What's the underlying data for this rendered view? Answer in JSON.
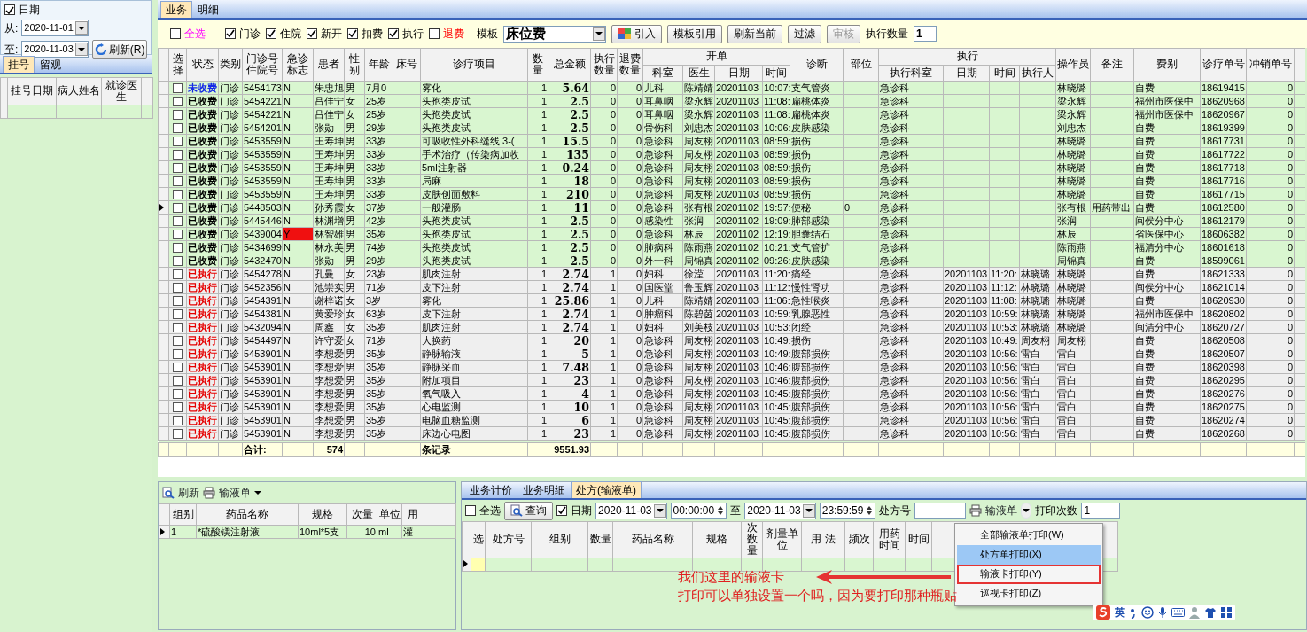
{
  "filter_panel": {
    "date_filter": {
      "label": "日期",
      "checked": true
    },
    "from_label": "从:",
    "from_date": "2020-11-01",
    "to_label": "至:",
    "to_date": "2020-11-03",
    "refresh_button": "刷新(R)"
  },
  "left_tabs": [
    {
      "label": "挂号",
      "selected": true
    },
    {
      "label": "留观",
      "selected": false
    }
  ],
  "registration_table": {
    "columns": [
      "挂号日期",
      "病人姓名",
      "就诊医生"
    ]
  },
  "main_tabs": [
    {
      "label": "业务",
      "selected": true
    },
    {
      "label": "明细",
      "selected": false
    }
  ],
  "toolbar": {
    "filters": [
      {
        "label": "全选",
        "checked": false,
        "kind": "all"
      },
      {
        "label": "门诊",
        "checked": true,
        "kind": "filter"
      },
      {
        "label": "住院",
        "checked": true,
        "kind": "filter"
      },
      {
        "label": "新开",
        "checked": true,
        "kind": "filter"
      },
      {
        "label": "扣费",
        "checked": true,
        "kind": "filter"
      },
      {
        "label": "执行",
        "checked": true,
        "kind": "filter"
      },
      {
        "label": "退费",
        "checked": false,
        "kind": "refund"
      }
    ],
    "template_label": "模板",
    "template_value": "床位费",
    "buttons": [
      {
        "label": "引入",
        "kind": "import",
        "disabled": false
      },
      {
        "label": "模板引用",
        "kind": "plain",
        "disabled": false
      },
      {
        "label": "刷新当前",
        "kind": "plain",
        "disabled": false
      },
      {
        "label": "过滤",
        "kind": "plain",
        "disabled": false
      },
      {
        "label": "审核",
        "kind": "plain",
        "disabled": true
      }
    ],
    "exec_count_label": "执行数量",
    "exec_count": "1"
  },
  "main_table": {
    "headers": [
      "选择",
      "状态",
      "类别",
      "门诊号住院号",
      "急诊标志",
      "患者",
      "性别",
      "年龄",
      "床号",
      "诊疗项目",
      "数量",
      "总金额",
      "执行数量",
      "退费数量",
      {
        "label": "开单",
        "children": [
          "科室",
          "医生",
          "日期",
          "时间"
        ]
      },
      "诊断",
      "部位",
      {
        "label": "执行",
        "children": [
          "执行科室",
          "日期",
          "时间",
          "执行人"
        ]
      },
      "操作员",
      "备注",
      "费别",
      "诊疗单号",
      "冲销单号"
    ],
    "rows": [
      {
        "kind": "unpaid",
        "checked": false,
        "current": false,
        "urgent": false,
        "status": "未收费",
        "category": "门诊",
        "visit_no": "5454173",
        "emergency": "N",
        "patient": "朱忠旭",
        "sex": "男",
        "age": "7月0",
        "item": "雾化",
        "qty": "1",
        "amount": "5.64",
        "exec_qty": "0",
        "refund_qty": "0",
        "order_dept": "儿科",
        "doctor": "陈靖婧",
        "order_date": "20201103",
        "order_time": "10:07:",
        "diagnosis": "支气管炎",
        "exec_dept": "急诊科",
        "operator": "林晓璐",
        "fee_type": "自费",
        "order_no": "18619415",
        "reversal_no": "0"
      },
      {
        "kind": "paid",
        "checked": false,
        "current": false,
        "urgent": false,
        "status": "已收费",
        "category": "门诊",
        "visit_no": "5454221",
        "emergency": "N",
        "patient": "吕佳宁",
        "sex": "女",
        "age": "25岁",
        "item": "头孢类皮试",
        "qty": "1",
        "amount": "2.5",
        "exec_qty": "0",
        "refund_qty": "0",
        "order_dept": "耳鼻咽",
        "doctor": "梁永辉",
        "order_date": "20201103",
        "order_time": "11:08:",
        "diagnosis": "扁桃体炎",
        "exec_dept": "急诊科",
        "operator": "梁永辉",
        "fee_type": "福州市医保中",
        "order_no": "18620968",
        "reversal_no": "0"
      },
      {
        "kind": "paid",
        "checked": false,
        "current": false,
        "urgent": false,
        "status": "已收费",
        "category": "门诊",
        "visit_no": "5454221",
        "emergency": "N",
        "patient": "吕佳宁",
        "sex": "女",
        "age": "25岁",
        "item": "头孢类皮试",
        "qty": "1",
        "amount": "2.5",
        "exec_qty": "0",
        "refund_qty": "0",
        "order_dept": "耳鼻咽",
        "doctor": "梁永辉",
        "order_date": "20201103",
        "order_time": "11:08:",
        "diagnosis": "扁桃体炎",
        "exec_dept": "急诊科",
        "operator": "梁永辉",
        "fee_type": "福州市医保中",
        "order_no": "18620967",
        "reversal_no": "0"
      },
      {
        "kind": "paid",
        "checked": false,
        "current": false,
        "urgent": false,
        "status": "已收费",
        "category": "门诊",
        "visit_no": "5454201",
        "emergency": "N",
        "patient": "张勋",
        "sex": "男",
        "age": "29岁",
        "item": "头孢类皮试",
        "qty": "1",
        "amount": "2.5",
        "exec_qty": "0",
        "refund_qty": "0",
        "order_dept": "骨伤科",
        "doctor": "刘忠杰",
        "order_date": "20201103",
        "order_time": "10:06:",
        "diagnosis": "皮肤感染",
        "exec_dept": "急诊科",
        "operator": "刘忠杰",
        "fee_type": "自费",
        "order_no": "18619399",
        "reversal_no": "0"
      },
      {
        "kind": "paid",
        "checked": false,
        "current": false,
        "urgent": false,
        "status": "已收费",
        "category": "门诊",
        "visit_no": "5453559",
        "emergency": "N",
        "patient": "王寿坤",
        "sex": "男",
        "age": "33岁",
        "item": "可吸收性外科缝线 3-(",
        "qty": "1",
        "amount": "15.5",
        "exec_qty": "0",
        "refund_qty": "0",
        "order_dept": "急诊科",
        "doctor": "周友栩",
        "order_date": "20201103",
        "order_time": "08:59:",
        "diagnosis": "损伤",
        "exec_dept": "急诊科",
        "operator": "林晓璐",
        "fee_type": "自费",
        "order_no": "18617731",
        "reversal_no": "0"
      },
      {
        "kind": "paid",
        "checked": false,
        "current": false,
        "urgent": false,
        "status": "已收费",
        "category": "门诊",
        "visit_no": "5453559",
        "emergency": "N",
        "patient": "王寿坤",
        "sex": "男",
        "age": "33岁",
        "item": "手术治疗（传染病加收",
        "qty": "1",
        "amount": "135",
        "exec_qty": "0",
        "refund_qty": "0",
        "order_dept": "急诊科",
        "doctor": "周友栩",
        "order_date": "20201103",
        "order_time": "08:59:",
        "diagnosis": "损伤",
        "exec_dept": "急诊科",
        "operator": "林晓璐",
        "fee_type": "自费",
        "order_no": "18617722",
        "reversal_no": "0"
      },
      {
        "kind": "paid",
        "checked": false,
        "current": false,
        "urgent": false,
        "status": "已收费",
        "category": "门诊",
        "visit_no": "5453559",
        "emergency": "N",
        "patient": "王寿坤",
        "sex": "男",
        "age": "33岁",
        "item": "5ml注射器",
        "qty": "1",
        "amount": "0.24",
        "exec_qty": "0",
        "refund_qty": "0",
        "order_dept": "急诊科",
        "doctor": "周友栩",
        "order_date": "20201103",
        "order_time": "08:59:",
        "diagnosis": "损伤",
        "exec_dept": "急诊科",
        "operator": "林晓璐",
        "fee_type": "自费",
        "order_no": "18617718",
        "reversal_no": "0"
      },
      {
        "kind": "paid",
        "checked": false,
        "current": false,
        "urgent": false,
        "status": "已收费",
        "category": "门诊",
        "visit_no": "5453559",
        "emergency": "N",
        "patient": "王寿坤",
        "sex": "男",
        "age": "33岁",
        "item": "局麻",
        "qty": "1",
        "amount": "18",
        "exec_qty": "0",
        "refund_qty": "0",
        "order_dept": "急诊科",
        "doctor": "周友栩",
        "order_date": "20201103",
        "order_time": "08:59:",
        "diagnosis": "损伤",
        "exec_dept": "急诊科",
        "operator": "林晓璐",
        "fee_type": "自费",
        "order_no": "18617716",
        "reversal_no": "0"
      },
      {
        "kind": "paid",
        "checked": false,
        "current": false,
        "urgent": false,
        "status": "已收费",
        "category": "门诊",
        "visit_no": "5453559",
        "emergency": "N",
        "patient": "王寿坤",
        "sex": "男",
        "age": "33岁",
        "item": "皮肤创面敷料",
        "qty": "1",
        "amount": "210",
        "exec_qty": "0",
        "refund_qty": "0",
        "order_dept": "急诊科",
        "doctor": "周友栩",
        "order_date": "20201103",
        "order_time": "08:59:",
        "diagnosis": "损伤",
        "exec_dept": "急诊科",
        "operator": "林晓璐",
        "fee_type": "自费",
        "order_no": "18617715",
        "reversal_no": "0"
      },
      {
        "kind": "paid",
        "checked": false,
        "current": true,
        "urgent": false,
        "status": "已收费",
        "category": "门诊",
        "visit_no": "5448503",
        "emergency": "N",
        "patient": "孙秀霞",
        "sex": "女",
        "age": "37岁",
        "item": "一般灌肠",
        "qty": "1",
        "amount": "11",
        "exec_qty": "0",
        "refund_qty": "0",
        "order_dept": "急诊科",
        "doctor": "张有根",
        "order_date": "20201102",
        "order_time": "19:57:",
        "diagnosis": "便秘",
        "site": "0",
        "exec_dept": "急诊科",
        "operator": "张有根",
        "note": "用药带出",
        "fee_type": "自费",
        "order_no": "18612580",
        "reversal_no": "0"
      },
      {
        "kind": "paid",
        "checked": false,
        "current": false,
        "urgent": false,
        "status": "已收费",
        "category": "门诊",
        "visit_no": "5445446",
        "emergency": "N",
        "patient": "林渊增",
        "sex": "男",
        "age": "42岁",
        "item": "头孢类皮试",
        "qty": "1",
        "amount": "2.5",
        "exec_qty": "0",
        "refund_qty": "0",
        "order_dept": "感染性",
        "doctor": "张润",
        "order_date": "20201102",
        "order_time": "19:09:",
        "diagnosis": "肺部感染",
        "exec_dept": "急诊科",
        "operator": "张润",
        "fee_type": "闽侯分中心",
        "order_no": "18612179",
        "reversal_no": "0"
      },
      {
        "kind": "paid",
        "checked": false,
        "current": false,
        "urgent": true,
        "status": "已收费",
        "category": "门诊",
        "visit_no": "5439004",
        "emergency": "Y",
        "patient": "林智雄",
        "sex": "男",
        "age": "35岁",
        "item": "头孢类皮试",
        "qty": "1",
        "amount": "2.5",
        "exec_qty": "0",
        "refund_qty": "0",
        "order_dept": "急诊科",
        "doctor": "林辰",
        "order_date": "20201102",
        "order_time": "12:19:",
        "diagnosis": "胆囊结石",
        "exec_dept": "急诊科",
        "operator": "林辰",
        "fee_type": "省医保中心",
        "order_no": "18606382",
        "reversal_no": "0"
      },
      {
        "kind": "paid",
        "checked": false,
        "current": false,
        "urgent": false,
        "status": "已收费",
        "category": "门诊",
        "visit_no": "5434699",
        "emergency": "N",
        "patient": "林永美",
        "sex": "男",
        "age": "74岁",
        "item": "头孢类皮试",
        "qty": "1",
        "amount": "2.5",
        "exec_qty": "0",
        "refund_qty": "0",
        "order_dept": "肺病科",
        "doctor": "陈雨燕",
        "order_date": "20201102",
        "order_time": "10:21:",
        "diagnosis": "支气管扩",
        "exec_dept": "急诊科",
        "operator": "陈雨燕",
        "fee_type": "福清分中心",
        "order_no": "18601618",
        "reversal_no": "0"
      },
      {
        "kind": "paid",
        "checked": false,
        "current": false,
        "urgent": false,
        "status": "已收费",
        "category": "门诊",
        "visit_no": "5432470",
        "emergency": "N",
        "patient": "张勋",
        "sex": "男",
        "age": "29岁",
        "item": "头孢类皮试",
        "qty": "1",
        "amount": "2.5",
        "exec_qty": "0",
        "refund_qty": "0",
        "order_dept": "外一科",
        "doctor": "周锦真",
        "order_date": "20201102",
        "order_time": "09:26:",
        "diagnosis": "皮肤感染",
        "exec_dept": "急诊科",
        "operator": "周锦真",
        "fee_type": "自费",
        "order_no": "18599061",
        "reversal_no": "0"
      },
      {
        "kind": "executed",
        "checked": false,
        "current": false,
        "urgent": false,
        "status": "已执行",
        "category": "门诊",
        "visit_no": "5454278",
        "emergency": "N",
        "patient": "孔曼",
        "sex": "女",
        "age": "23岁",
        "item": "肌肉注射",
        "qty": "1",
        "amount": "2.74",
        "exec_qty": "1",
        "refund_qty": "0",
        "order_dept": "妇科",
        "doctor": "徐滢",
        "order_date": "20201103",
        "order_time": "11:20:",
        "diagnosis": "痛经",
        "exec_dept": "急诊科",
        "exec_date": "20201103",
        "exec_time": "11:20:",
        "executor": "林晓璐",
        "operator": "林晓璐",
        "fee_type": "自费",
        "order_no": "18621333",
        "reversal_no": "0"
      },
      {
        "kind": "executed",
        "checked": false,
        "current": false,
        "urgent": false,
        "status": "已执行",
        "category": "门诊",
        "visit_no": "5452356",
        "emergency": "N",
        "patient": "池崇实",
        "sex": "男",
        "age": "71岁",
        "item": "皮下注射",
        "qty": "1",
        "amount": "2.74",
        "exec_qty": "1",
        "refund_qty": "0",
        "order_dept": "国医堂",
        "doctor": "鲁玉辉",
        "order_date": "20201103",
        "order_time": "11:12:",
        "diagnosis": "慢性肾功",
        "exec_dept": "急诊科",
        "exec_date": "20201103",
        "exec_time": "11:12:",
        "executor": "林晓璐",
        "operator": "林晓璐",
        "fee_type": "闽侯分中心",
        "order_no": "18621014",
        "reversal_no": "0"
      },
      {
        "kind": "executed",
        "checked": false,
        "current": false,
        "urgent": false,
        "status": "已执行",
        "category": "门诊",
        "visit_no": "5454391",
        "emergency": "N",
        "patient": "谢梓诺",
        "sex": "女",
        "age": "3岁",
        "item": "雾化",
        "qty": "1",
        "amount": "25.86",
        "exec_qty": "1",
        "refund_qty": "0",
        "order_dept": "儿科",
        "doctor": "陈靖婧",
        "order_date": "20201103",
        "order_time": "11:06:",
        "diagnosis": "急性喉炎",
        "exec_dept": "急诊科",
        "exec_date": "20201103",
        "exec_time": "11:08:",
        "executor": "林晓璐",
        "operator": "林晓璐",
        "fee_type": "自费",
        "order_no": "18620930",
        "reversal_no": "0"
      },
      {
        "kind": "executed",
        "checked": false,
        "current": false,
        "urgent": false,
        "status": "已执行",
        "category": "门诊",
        "visit_no": "5454381",
        "emergency": "N",
        "patient": "黄爱珍",
        "sex": "女",
        "age": "63岁",
        "item": "皮下注射",
        "qty": "1",
        "amount": "2.74",
        "exec_qty": "1",
        "refund_qty": "0",
        "order_dept": "肿瘤科",
        "doctor": "陈碧茵",
        "order_date": "20201103",
        "order_time": "10:59:",
        "diagnosis": "乳腺恶性",
        "exec_dept": "急诊科",
        "exec_date": "20201103",
        "exec_time": "10:59:",
        "executor": "林晓璐",
        "operator": "林晓璐",
        "fee_type": "福州市医保中",
        "order_no": "18620802",
        "reversal_no": "0"
      },
      {
        "kind": "executed",
        "checked": false,
        "current": false,
        "urgent": false,
        "status": "已执行",
        "category": "门诊",
        "visit_no": "5432094",
        "emergency": "N",
        "patient": "周鑫",
        "sex": "女",
        "age": "35岁",
        "item": "肌肉注射",
        "qty": "1",
        "amount": "2.74",
        "exec_qty": "1",
        "refund_qty": "0",
        "order_dept": "妇科",
        "doctor": "刘美枝",
        "order_date": "20201103",
        "order_time": "10:53:",
        "diagnosis": "闭经",
        "exec_dept": "急诊科",
        "exec_date": "20201103",
        "exec_time": "10:53:",
        "executor": "林晓璐",
        "operator": "林晓璐",
        "fee_type": "闽清分中心",
        "order_no": "18620727",
        "reversal_no": "0"
      },
      {
        "kind": "executed",
        "checked": false,
        "current": false,
        "urgent": false,
        "status": "已执行",
        "category": "门诊",
        "visit_no": "5454497",
        "emergency": "N",
        "patient": "许守爱",
        "sex": "女",
        "age": "71岁",
        "item": "大换药",
        "qty": "1",
        "amount": "20",
        "exec_qty": "1",
        "refund_qty": "0",
        "order_dept": "急诊科",
        "doctor": "周友栩",
        "order_date": "20201103",
        "order_time": "10:49:",
        "diagnosis": "损伤",
        "exec_dept": "急诊科",
        "exec_date": "20201103",
        "exec_time": "10:49:",
        "executor": "周友栩",
        "operator": "周友栩",
        "fee_type": "自费",
        "order_no": "18620508",
        "reversal_no": "0"
      },
      {
        "kind": "executed",
        "checked": false,
        "current": false,
        "urgent": false,
        "status": "已执行",
        "category": "门诊",
        "visit_no": "5453901",
        "emergency": "N",
        "patient": "李想爱",
        "sex": "男",
        "age": "35岁",
        "item": "静脉输液",
        "qty": "1",
        "amount": "5",
        "exec_qty": "1",
        "refund_qty": "0",
        "order_dept": "急诊科",
        "doctor": "周友栩",
        "order_date": "20201103",
        "order_time": "10:49:",
        "diagnosis": "腹部损伤",
        "exec_dept": "急诊科",
        "exec_date": "20201103",
        "exec_time": "10:56:",
        "executor": "雷白",
        "operator": "雷白",
        "fee_type": "自费",
        "order_no": "18620507",
        "reversal_no": "0"
      },
      {
        "kind": "executed",
        "checked": false,
        "current": false,
        "urgent": false,
        "status": "已执行",
        "category": "门诊",
        "visit_no": "5453901",
        "emergency": "N",
        "patient": "李想爱",
        "sex": "男",
        "age": "35岁",
        "item": "静脉采血",
        "qty": "1",
        "amount": "7.48",
        "exec_qty": "1",
        "refund_qty": "0",
        "order_dept": "急诊科",
        "doctor": "周友栩",
        "order_date": "20201103",
        "order_time": "10:46:",
        "diagnosis": "腹部损伤",
        "exec_dept": "急诊科",
        "exec_date": "20201103",
        "exec_time": "10:56:",
        "executor": "雷白",
        "operator": "雷白",
        "fee_type": "自费",
        "order_no": "18620398",
        "reversal_no": "0"
      },
      {
        "kind": "executed",
        "checked": false,
        "current": false,
        "urgent": false,
        "status": "已执行",
        "category": "门诊",
        "visit_no": "5453901",
        "emergency": "N",
        "patient": "李想爱",
        "sex": "男",
        "age": "35岁",
        "item": "附加项目",
        "qty": "1",
        "amount": "23",
        "exec_qty": "1",
        "refund_qty": "0",
        "order_dept": "急诊科",
        "doctor": "周友栩",
        "order_date": "20201103",
        "order_time": "10:46:",
        "diagnosis": "腹部损伤",
        "exec_dept": "急诊科",
        "exec_date": "20201103",
        "exec_time": "10:56:",
        "executor": "雷白",
        "operator": "雷白",
        "fee_type": "自费",
        "order_no": "18620295",
        "reversal_no": "0"
      },
      {
        "kind": "executed",
        "checked": false,
        "current": false,
        "urgent": false,
        "status": "已执行",
        "category": "门诊",
        "visit_no": "5453901",
        "emergency": "N",
        "patient": "李想爱",
        "sex": "男",
        "age": "35岁",
        "item": "氧气吸入",
        "qty": "1",
        "amount": "4",
        "exec_qty": "1",
        "refund_qty": "0",
        "order_dept": "急诊科",
        "doctor": "周友栩",
        "order_date": "20201103",
        "order_time": "10:45:",
        "diagnosis": "腹部损伤",
        "exec_dept": "急诊科",
        "exec_date": "20201103",
        "exec_time": "10:56:",
        "executor": "雷白",
        "operator": "雷白",
        "fee_type": "自费",
        "order_no": "18620276",
        "reversal_no": "0"
      },
      {
        "kind": "executed",
        "checked": false,
        "current": false,
        "urgent": false,
        "status": "已执行",
        "category": "门诊",
        "visit_no": "5453901",
        "emergency": "N",
        "patient": "李想爱",
        "sex": "男",
        "age": "35岁",
        "item": "心电监测",
        "qty": "1",
        "amount": "10",
        "exec_qty": "1",
        "refund_qty": "0",
        "order_dept": "急诊科",
        "doctor": "周友栩",
        "order_date": "20201103",
        "order_time": "10:45:",
        "diagnosis": "腹部损伤",
        "exec_dept": "急诊科",
        "exec_date": "20201103",
        "exec_time": "10:56:",
        "executor": "雷白",
        "operator": "雷白",
        "fee_type": "自费",
        "order_no": "18620275",
        "reversal_no": "0"
      },
      {
        "kind": "executed",
        "checked": false,
        "current": false,
        "urgent": false,
        "status": "已执行",
        "category": "门诊",
        "visit_no": "5453901",
        "emergency": "N",
        "patient": "李想爱",
        "sex": "男",
        "age": "35岁",
        "item": "电脑血糖监测",
        "qty": "1",
        "amount": "6",
        "exec_qty": "1",
        "refund_qty": "0",
        "order_dept": "急诊科",
        "doctor": "周友栩",
        "order_date": "20201103",
        "order_time": "10:45:",
        "diagnosis": "腹部损伤",
        "exec_dept": "急诊科",
        "exec_date": "20201103",
        "exec_time": "10:56:",
        "executor": "雷白",
        "operator": "雷白",
        "fee_type": "自费",
        "order_no": "18620274",
        "reversal_no": "0"
      },
      {
        "kind": "executed",
        "checked": false,
        "current": false,
        "urgent": false,
        "status": "已执行",
        "category": "门诊",
        "visit_no": "5453901",
        "emergency": "N",
        "patient": "李想爱",
        "sex": "男",
        "age": "35岁",
        "item": "床边心电图",
        "qty": "1",
        "amount": "23",
        "exec_qty": "1",
        "refund_qty": "0",
        "order_dept": "急诊科",
        "doctor": "周友栩",
        "order_date": "20201103",
        "order_time": "10:45:",
        "diagnosis": "腹部损伤",
        "exec_dept": "急诊科",
        "exec_date": "20201103",
        "exec_time": "10:56:",
        "executor": "雷白",
        "operator": "雷白",
        "fee_type": "自费",
        "order_no": "18620268",
        "reversal_no": "0"
      }
    ],
    "totals": {
      "label": "合计:",
      "patient_count": "574",
      "records_label": "条记录",
      "amount": "9551.93"
    }
  },
  "infusion_panel": {
    "refresh_button": "刷新",
    "print_button": "输液单",
    "columns": [
      "组别",
      "药品名称",
      "规格",
      "次量",
      "单位",
      "用"
    ],
    "rows": [
      {
        "current": true,
        "group": "1",
        "drug": "*硫酸镁注射液",
        "spec": "10ml*5支",
        "dose": "10",
        "unit": "ml",
        "usage": "灌"
      }
    ]
  },
  "prescription_panel": {
    "tabs": [
      {
        "label": "业务计价",
        "selected": false
      },
      {
        "label": "业务明细",
        "selected": false
      },
      {
        "label": "处方(输液单)",
        "selected": true
      }
    ],
    "select_all": {
      "label": "全选",
      "checked": false
    },
    "query_button": "查询",
    "date_filter": {
      "label": "日期",
      "checked": true
    },
    "start_date": "2020-11-03",
    "start_time": "00:00:00",
    "to_label": "至",
    "end_date": "2020-11-03",
    "end_time": "23:59:59",
    "rx_label": "处方号",
    "print_button": "输液单",
    "print_count_label": "打印次数",
    "print_count": "1",
    "columns": [
      "选",
      "处方号",
      "组别",
      "数量",
      "药品名称",
      "规格",
      "次数量",
      "剂量单位",
      "用 法",
      "频次",
      "用药时间",
      "时间"
    ],
    "rows": [
      {
        "current": true
      }
    ]
  },
  "print_menu": {
    "items": [
      {
        "label": "全部输液单打印(W)",
        "selected": false,
        "boxed": false
      },
      {
        "label": "处方单打印(X)",
        "selected": true,
        "boxed": false
      },
      {
        "label": "输液卡打印(Y)",
        "selected": false,
        "boxed": true
      },
      {
        "label": "巡视卡打印(Z)",
        "selected": false,
        "boxed": false
      }
    ]
  },
  "annotation": {
    "lines": [
      "我们这里的输液卡",
      "打印可以单独设置一个吗，因为要打印那种瓶贴"
    ]
  },
  "ime_toolbar": {
    "mode": "英"
  }
}
